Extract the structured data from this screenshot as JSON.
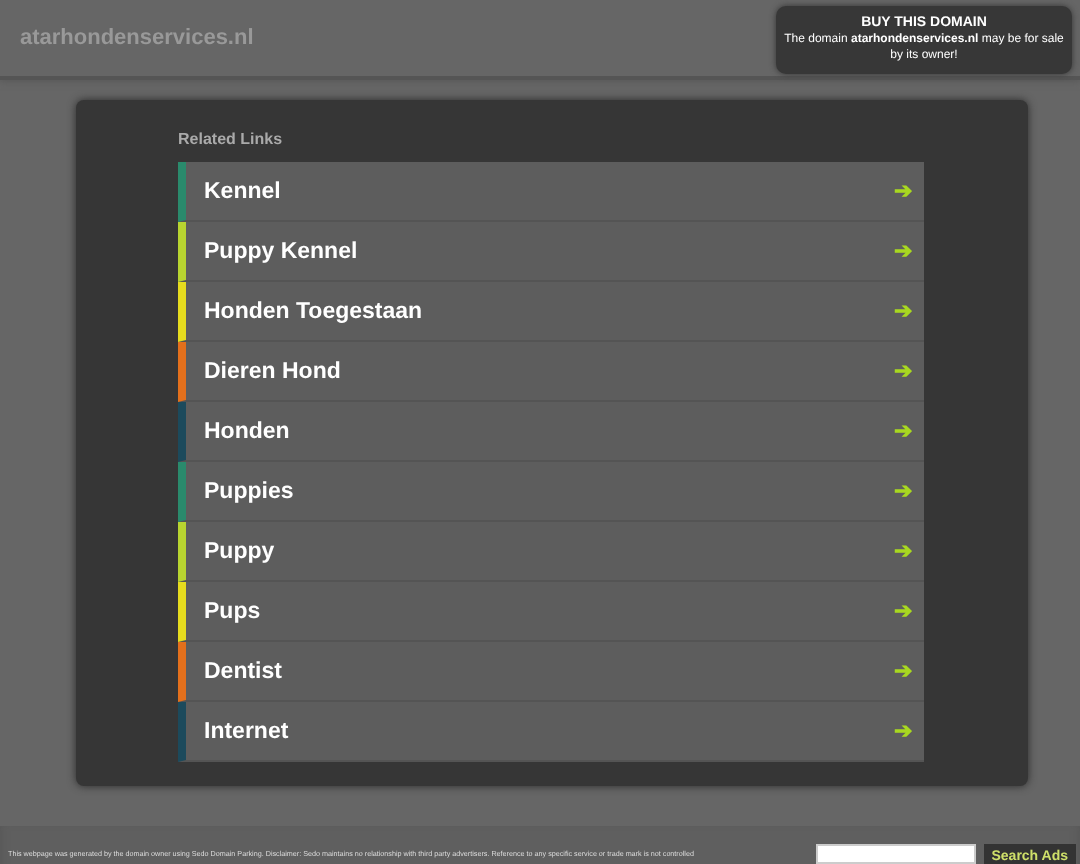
{
  "header": {
    "domain": "atarhondenservices.nl",
    "buy_box": {
      "title": "BUY THIS DOMAIN",
      "text": "The domain **atarhondenservices.nl** may be for sale by its owner!"
    }
  },
  "related_links": {
    "heading": "Related Links",
    "items": [
      {
        "label": "Kennel",
        "color": "#2a8a6c"
      },
      {
        "label": "Puppy Kennel",
        "color": "#b8d430"
      },
      {
        "label": "Honden Toegestaan",
        "color": "#e6dc1e"
      },
      {
        "label": "Dieren Hond",
        "color": "#e4701c"
      },
      {
        "label": "Honden",
        "color": "#1c4a5c"
      },
      {
        "label": "Puppies",
        "color": "#2a8a6c"
      },
      {
        "label": "Puppy",
        "color": "#b8d430"
      },
      {
        "label": "Pups",
        "color": "#e6dc1e"
      },
      {
        "label": "Dentist",
        "color": "#e4701c"
      },
      {
        "label": "Internet",
        "color": "#1c4a5c"
      }
    ],
    "arrow": "➔"
  },
  "footer": {
    "disclaimer": "This webpage was generated by the domain owner using Sedo Domain Parking. Disclaimer: Sedo maintains no relationship with third party advertisers. Reference to any specific service or trade mark is not controlled",
    "search_button": "Search Ads"
  }
}
